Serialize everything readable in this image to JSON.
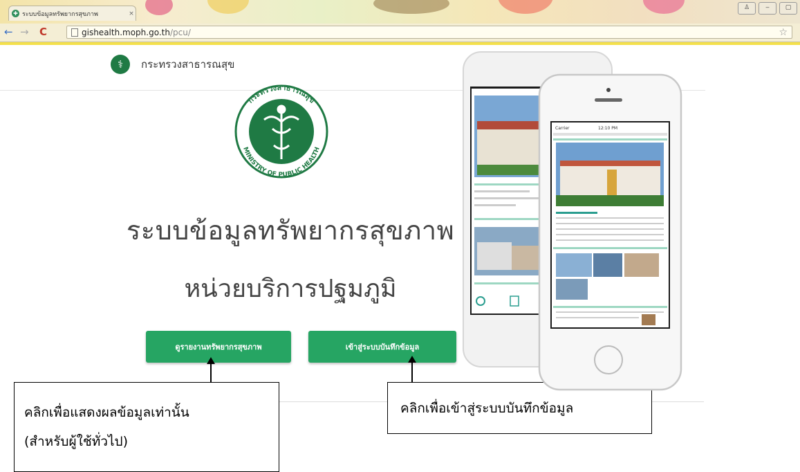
{
  "browser": {
    "tab_title": "ระบบข้อมูลทรัพยากรสุขภาพ",
    "tab_close": "×",
    "url_host": "gishealth.moph.go.th",
    "url_path": "/pcu/",
    "back": "←",
    "forward": "→",
    "reload": "C",
    "star": "☆",
    "window_buttons": [
      "♙",
      "‒",
      "▢"
    ]
  },
  "header": {
    "ministry_name": "กระทรวงสาธารณสุข"
  },
  "emblem": {
    "top_text": "กระทรวงสาธารณสุข",
    "bottom_text": "MINISTRY OF PUBLIC HEALTH"
  },
  "main": {
    "title": "ระบบข้อมูลทรัพยากรสุขภาพ",
    "subtitle": "หน่วยบริการปฐมภูมิ",
    "report_button": "ดูรายงานทรัพยากรสุขภาพ",
    "entry_button": "เข้าสู่ระบบบันทึกข้อมูล"
  },
  "callouts": {
    "left_line1": "คลิกเพื่อแสดงผลข้อมูลเท่านั้น",
    "left_line2": "(สำหรับผู้ใช้ทั่วไป)",
    "right": "คลิกเพื่อเข้าสู่ระบบบันทึกข้อมูล"
  },
  "phone": {
    "carrier": "Carrier",
    "time": "12:10 PM"
  },
  "colors": {
    "primary_green": "#26a563",
    "ministry_green": "#1f7a44"
  }
}
